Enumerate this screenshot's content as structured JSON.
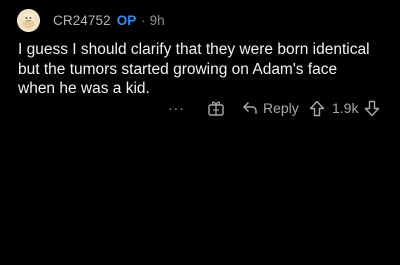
{
  "comment": {
    "author": "CR24752",
    "op_badge": "OP",
    "separator": "·",
    "age": "9h",
    "body_lines": [
      "I guess I should clarify that they were born identical",
      "but the tumors started growing on Adam's face",
      "when he was a kid."
    ]
  },
  "actions": {
    "more_label": "···",
    "reply_label": "Reply",
    "vote_count": "1.9k"
  },
  "colors": {
    "background": "#000000",
    "op_accent": "#3d8bf2",
    "meta_text": "#8e9094",
    "icon": "#a6a8ab"
  },
  "icons": {
    "avatar": "snoo-avatar-icon",
    "award": "award-gift-icon",
    "reply": "reply-arrow-icon",
    "upvote": "upvote-arrow-icon",
    "downvote": "downvote-arrow-icon"
  }
}
